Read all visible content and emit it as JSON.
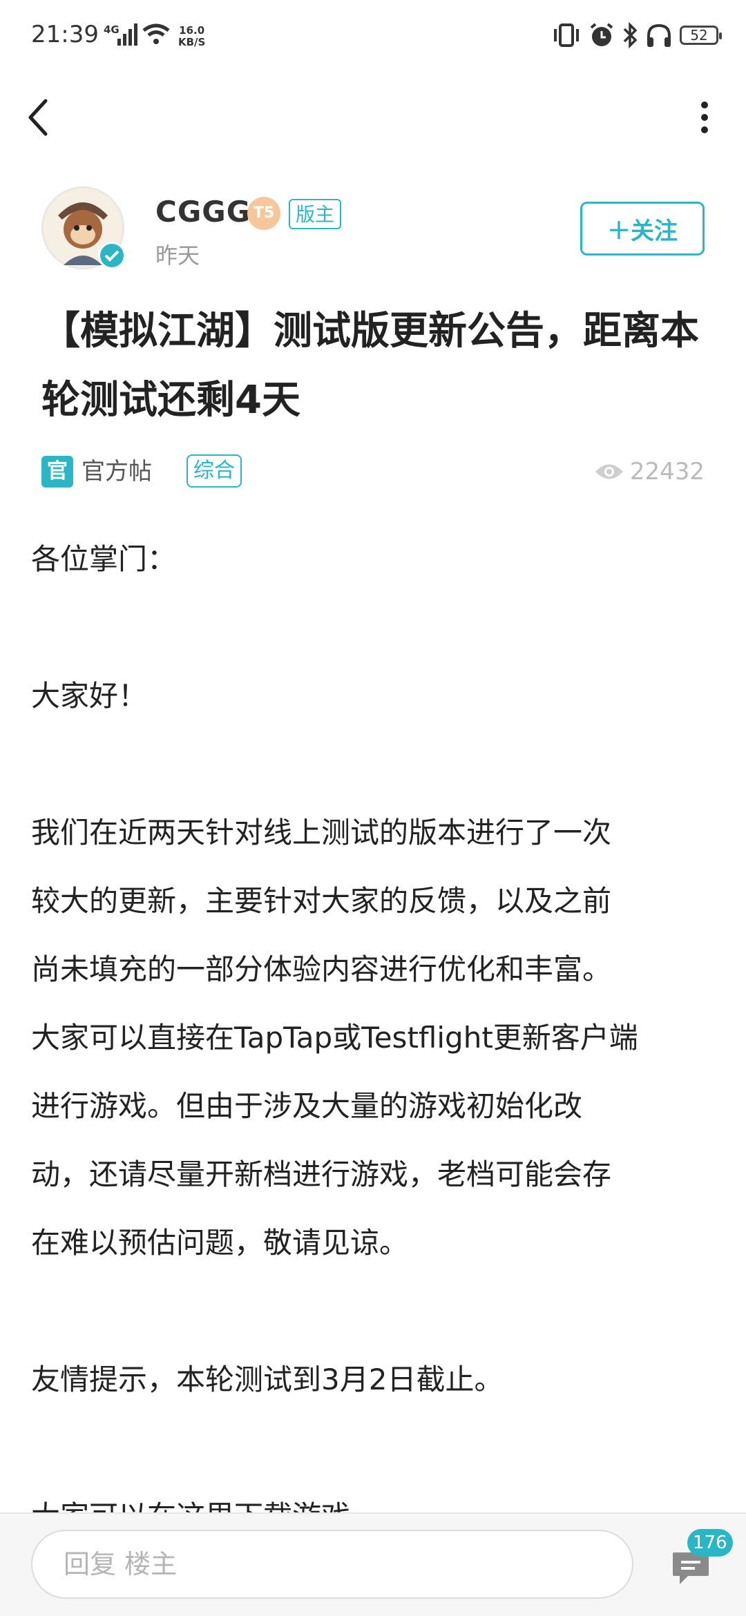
{
  "status_bar": {
    "time": "21:39",
    "network": "4G",
    "speed_value": "16.0",
    "speed_unit": "KB/S",
    "battery": "52"
  },
  "colors": {
    "accent": "#2ab6c6",
    "level_badge": "#f5c79a"
  },
  "author": {
    "name": "CGGG",
    "level_badge": "T5",
    "role_badge": "版主",
    "time": "昨天",
    "follow_label": "＋关注"
  },
  "post": {
    "title": "【模拟江湖】测试版更新公告，距离本轮测试还剩4天",
    "official_icon": "官",
    "official_label": "官方帖",
    "category": "综合",
    "views": "22432",
    "body": {
      "greeting": "各位掌门：",
      "hello": "大家好！",
      "paragraph1_lines": [
        "我们在近两天针对线上测试的版本进行了一次",
        "较大的更新，主要针对大家的反馈，以及之前",
        "尚未填充的一部分体验内容进行优化和丰富。",
        "大家可以直接在TapTap或Testflight更新客户端",
        "进行游戏。但由于涉及大量的游戏初始化改",
        "动，还请尽量开新档进行游戏，老档可能会存",
        "在难以预估问题，敬请见谅。"
      ],
      "reminder": "友情提示，本轮测试到3月2日截止。",
      "download_partial": "大家可以在这里下载游戏"
    }
  },
  "bottom_bar": {
    "reply_placeholder": "回复  楼主",
    "comment_count": "176"
  }
}
